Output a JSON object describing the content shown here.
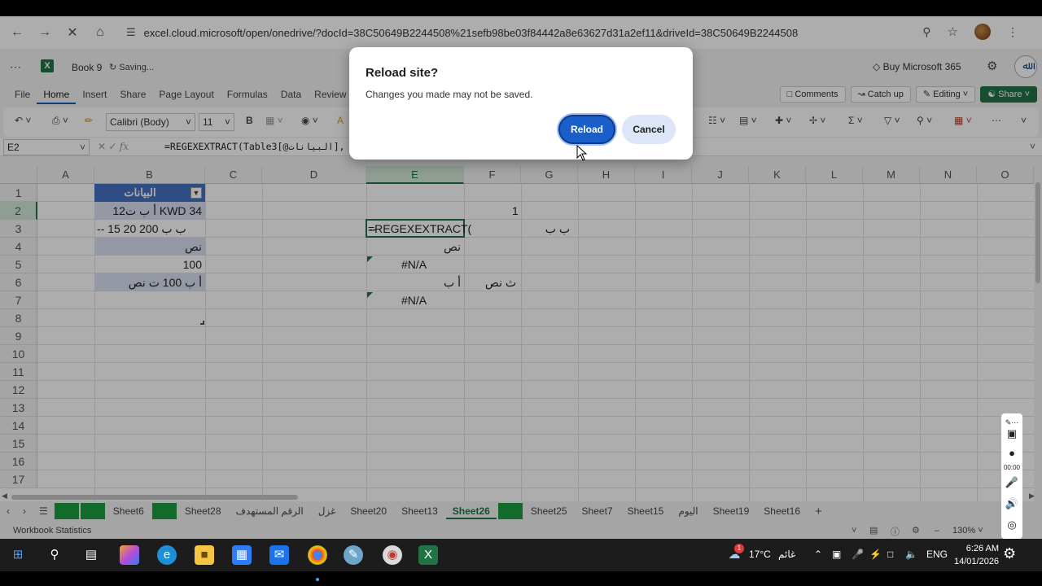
{
  "browser": {
    "url": "excel.cloud.microsoft/open/onedrive/?docId=38C50649B2244508%21sefb98be03f84442a8e63627d31a2ef11&driveId=38C50649B2244508"
  },
  "excel": {
    "book_name": "Book 9",
    "save_status": "Saving...",
    "buy_label": "Buy Microsoft 365",
    "menu_tabs": [
      "File",
      "Home",
      "Insert",
      "Share",
      "Page Layout",
      "Formulas",
      "Data",
      "Review"
    ],
    "active_tab": "Home",
    "comments_label": "Comments",
    "catchup_label": "Catch up",
    "editing_label": "Editing",
    "share_label": "Share",
    "font_name": "Calibri (Body)",
    "font_size": "11",
    "name_box": "E2",
    "formula": "=REGEXEXTRACT(Table3[@البيانات],"
  },
  "sheet": {
    "columns": [
      "A",
      "B",
      "C",
      "D",
      "E",
      "F",
      "G",
      "H",
      "I",
      "J",
      "K",
      "L",
      "M",
      "N",
      "O"
    ],
    "rows": [
      "1",
      "2",
      "3",
      "4",
      "5",
      "6",
      "7",
      "8",
      "9",
      "10",
      "11",
      "12",
      "13",
      "14",
      "15",
      "16",
      "17"
    ],
    "table_header": "البيانات",
    "b2": "12أ ب ت KWD 34",
    "b3": "-- 15 20 ب ب 200",
    "b4": "نص",
    "b5": "100",
    "b6": "أ ب 100 ت نص",
    "e2": "=REGEXEXTRACT(",
    "f2": "1",
    "e3": "--",
    "g3": "ب ب",
    "e4": "نص",
    "e5": "#N/A",
    "e6": "أ ب",
    "f6": "ث نص",
    "e7": "#N/A"
  },
  "sheet_tabs": [
    "Sheet6",
    "Sheet28",
    "الرقم المستهدف",
    "غزل",
    "Sheet20",
    "Sheet13",
    "Sheet26",
    "Sheet25",
    "Sheet7",
    "Sheet15",
    "اليوم",
    "Sheet19",
    "Sheet16"
  ],
  "active_sheet": "Sheet26",
  "status": {
    "left": "Workbook Statistics",
    "zoom": "130%"
  },
  "dialog": {
    "title": "Reload site?",
    "message": "Changes you made may not be saved.",
    "reload_label": "Reload",
    "cancel_label": "Cancel"
  },
  "recorder": {
    "time": "00:00"
  },
  "taskbar": {
    "weather_temp": "17°C",
    "weather_text": "غائم",
    "lang": "ENG",
    "time": "6:26 AM",
    "date": "14/01/2026",
    "badge": "1"
  }
}
